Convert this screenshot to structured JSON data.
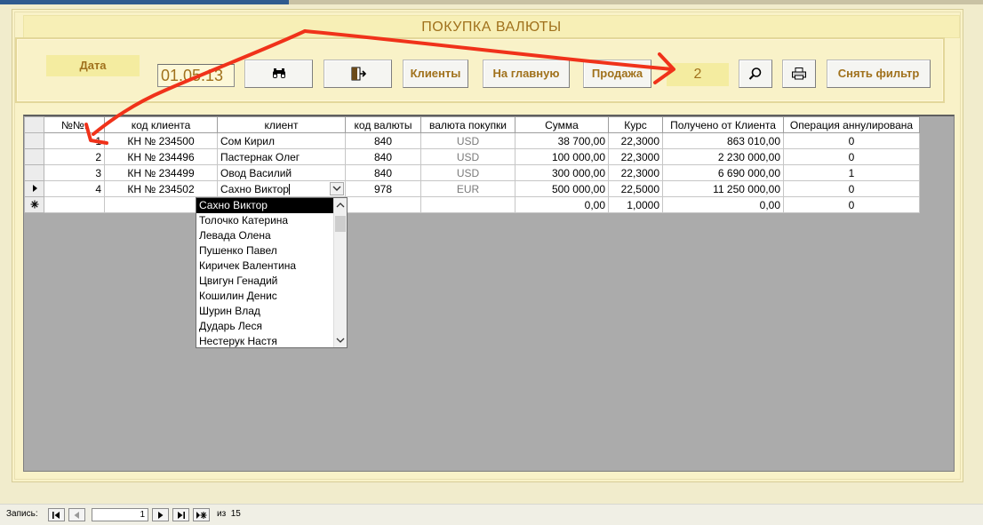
{
  "title": "ПОКУПКА ВАЛЮТЫ",
  "toolbar": {
    "date_label": "Дата",
    "date_value": "01.05.13",
    "find_icon": "binoculars-icon",
    "exit_icon": "exit-door-icon",
    "clients_label": "Клиенты",
    "home_label": "На главную",
    "sale_label": "Продажа",
    "filter_value": "2",
    "search_icon": "magnifier-icon",
    "print_icon": "printer-icon",
    "clear_filter_label": "Снять фильтр"
  },
  "grid": {
    "columns": [
      "№№:",
      "код клиента",
      "клиент",
      "код валюты",
      "валюта покупки",
      "Сумма",
      "Курс",
      "Получено от Клиента",
      "Операция аннулирована"
    ],
    "rows": [
      {
        "num": "1",
        "client_code": "КН № 234500",
        "client": "Сом Кирил",
        "currency_code": "840",
        "currency": "USD",
        "amount": "38 700,00",
        "rate": "22,3000",
        "received": "863 010,00",
        "cancelled": "0"
      },
      {
        "num": "2",
        "client_code": "КН № 234496",
        "client": "Пастернак Олег",
        "currency_code": "840",
        "currency": "USD",
        "amount": "100 000,00",
        "rate": "22,3000",
        "received": "2 230 000,00",
        "cancelled": "0"
      },
      {
        "num": "3",
        "client_code": "КН № 234499",
        "client": "Овод Василий",
        "currency_code": "840",
        "currency": "USD",
        "amount": "300 000,00",
        "rate": "22,3000",
        "received": "6 690 000,00",
        "cancelled": "1"
      },
      {
        "num": "4",
        "client_code": "КН № 234502",
        "client": "Сахно Виктор",
        "currency_code": "978",
        "currency": "EUR",
        "amount": "500 000,00",
        "rate": "22,5000",
        "received": "11 250 000,00",
        "cancelled": "0"
      }
    ],
    "new_row": {
      "amount": "0,00",
      "rate": "1,0000",
      "received": "0,00",
      "cancelled": "0"
    }
  },
  "dropdown": {
    "items": [
      "Сахно Виктор",
      "Толочко Катерина",
      "Левада Олена",
      "Пушенко Павел",
      "Киричек Валентина",
      "Цвигун Генадий",
      "Кошилин Денис",
      "Шурин Влад",
      "Дударь Леся",
      "Нестерук Настя"
    ],
    "selected_index": 0
  },
  "navigation": {
    "record_label": "Запись:",
    "current_record": "1",
    "of_label": "из",
    "total_records": "15"
  },
  "colors": {
    "form_bg": "#f9f2c8",
    "accent_text": "#a0711c",
    "annotation_arrow": "#f0321a"
  }
}
